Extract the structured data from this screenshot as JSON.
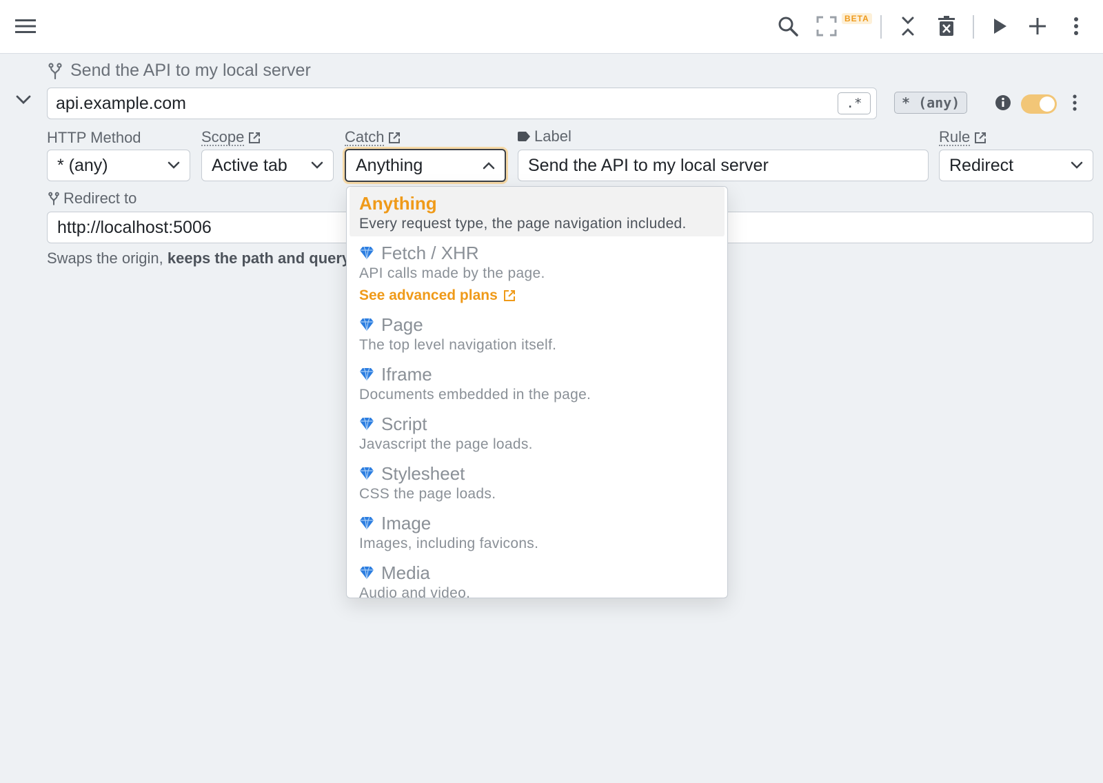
{
  "toolbar": {
    "beta_label": "BETA"
  },
  "rule": {
    "title": "Send the API to my local server",
    "url_value": "api.example.com",
    "regex_label": ".*",
    "method_badge": "* (any)"
  },
  "fields": {
    "http_method": {
      "label": "HTTP Method",
      "value": "* (any)"
    },
    "scope": {
      "label": "Scope",
      "value": "Active tab"
    },
    "catch": {
      "label": "Catch",
      "value": "Anything"
    },
    "label": {
      "label": "Label",
      "value": "Send the API to my local server"
    },
    "rule": {
      "label": "Rule",
      "value": "Redirect"
    },
    "redirect_to": {
      "label": "Redirect to",
      "value": "http://localhost:5006"
    }
  },
  "helper": {
    "prefix": "Swaps the origin, ",
    "bold": "keeps the path and query."
  },
  "dropdown": {
    "options": [
      {
        "title": "Anything",
        "desc": "Every request type, the page navigation included."
      },
      {
        "title": "Fetch / XHR",
        "desc": "API calls made by the page.",
        "link": "See advanced plans"
      },
      {
        "title": "Page",
        "desc": "The top level navigation itself."
      },
      {
        "title": "Iframe",
        "desc": "Documents embedded in the page."
      },
      {
        "title": "Script",
        "desc": "Javascript the page loads."
      },
      {
        "title": "Stylesheet",
        "desc": "CSS the page loads."
      },
      {
        "title": "Image",
        "desc": "Images, including favicons."
      },
      {
        "title": "Media",
        "desc": "Audio and video."
      }
    ]
  },
  "colors": {
    "accent": "#ef9a19",
    "premium_icon": "#2b7de0",
    "toggle_on": "#f2c677"
  }
}
